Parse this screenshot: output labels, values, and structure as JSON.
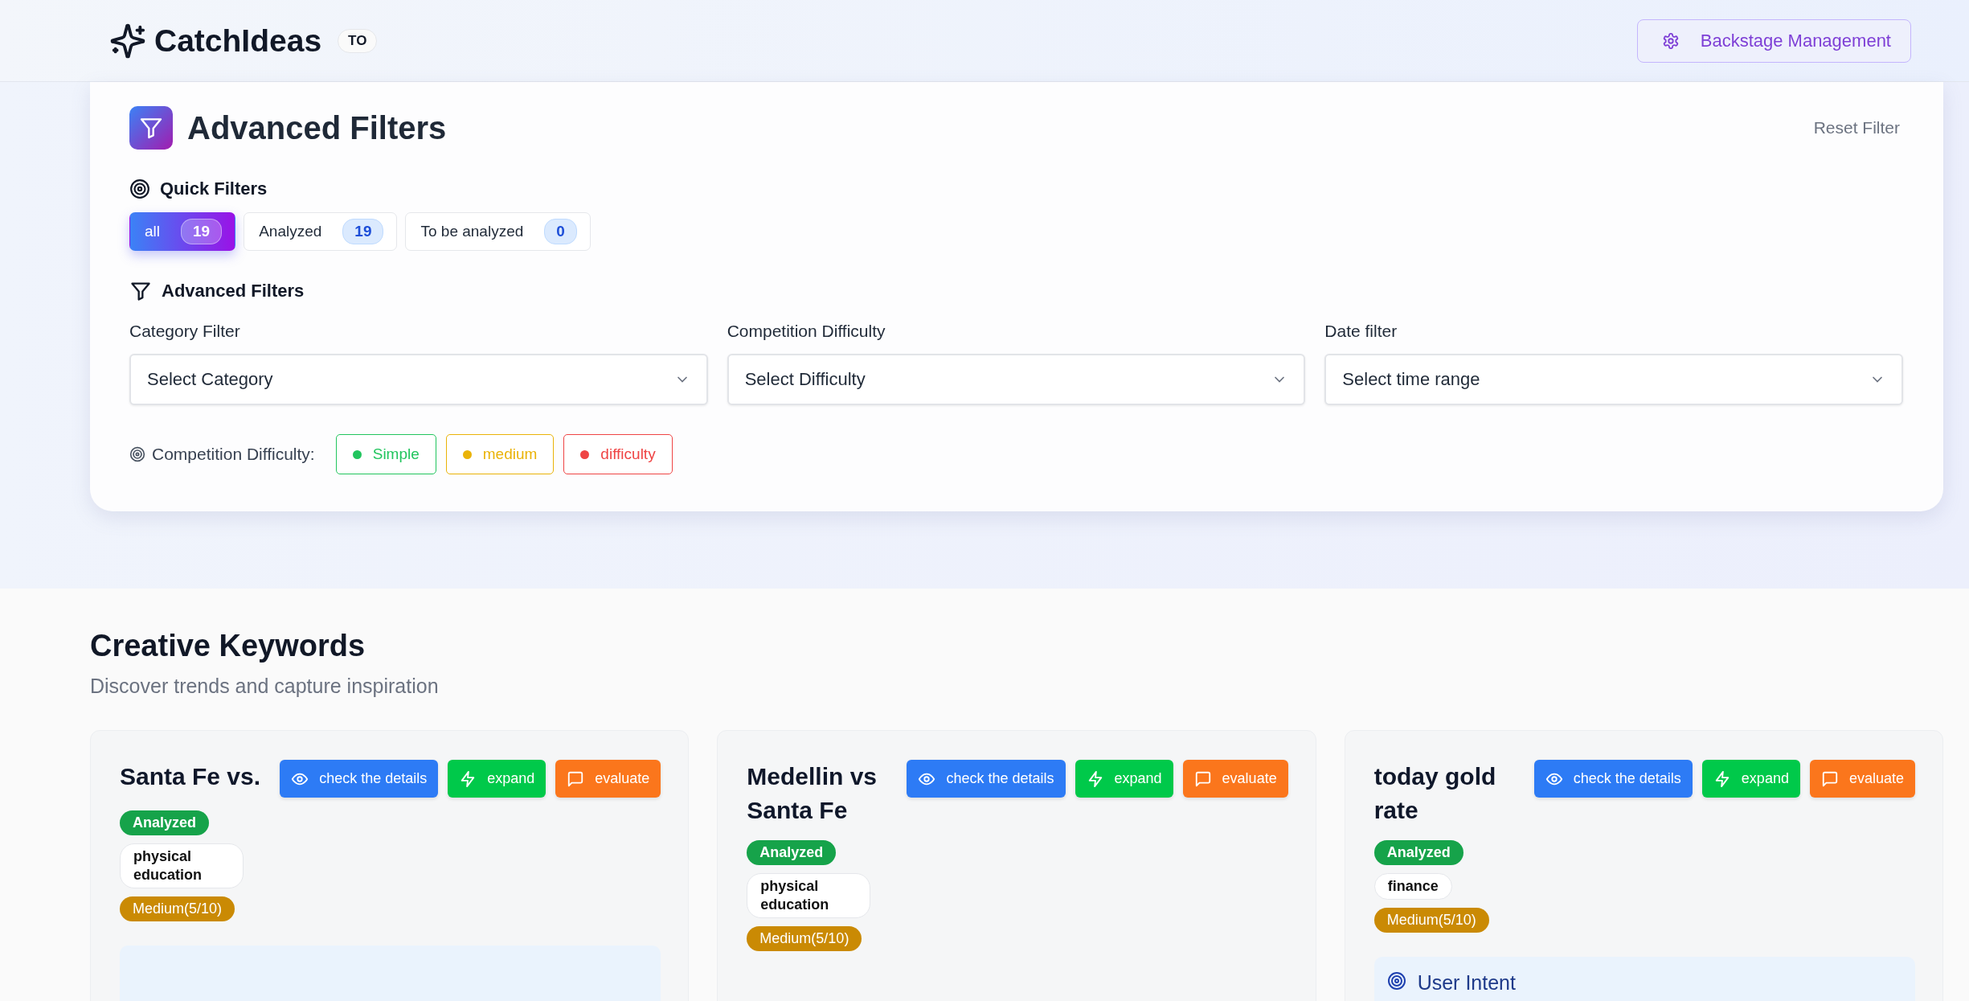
{
  "header": {
    "brand": "CatchIdeas",
    "badge": "TO",
    "admin_button": "Backstage Management"
  },
  "filters": {
    "title": "Advanced Filters",
    "reset": "Reset Filter",
    "quick_title": "Quick Filters",
    "quick": [
      {
        "label": "all",
        "count": "19",
        "selected": true
      },
      {
        "label": "Analyzed",
        "count": "19",
        "selected": false
      },
      {
        "label": "To be analyzed",
        "count": "0",
        "selected": false
      }
    ],
    "advanced_title": "Advanced Filters",
    "selects": [
      {
        "label": "Category Filter",
        "placeholder": "Select Category"
      },
      {
        "label": "Competition Difficulty",
        "placeholder": "Select Difficulty"
      },
      {
        "label": "Date filter",
        "placeholder": "Select time range"
      }
    ],
    "legend_label": "Competition Difficulty:",
    "legend": [
      {
        "label": "Simple",
        "color": "#22c55e"
      },
      {
        "label": "medium",
        "color": "#eab308"
      },
      {
        "label": "difficulty",
        "color": "#ef4444"
      }
    ]
  },
  "section": {
    "title": "Creative Keywords",
    "subtitle": "Discover trends and capture inspiration"
  },
  "cards": [
    {
      "title": "Santa Fe vs.",
      "status": "Analyzed",
      "category": "physical education",
      "difficulty": "Medium(5/10)",
      "buttons": [
        "check the details",
        "expand",
        "evaluate"
      ],
      "intent_panel": true
    },
    {
      "title": "Medellin vs Santa Fe",
      "status": "Analyzed",
      "category": "physical education",
      "difficulty": "Medium(5/10)",
      "buttons": [
        "check the details",
        "expand",
        "evaluate"
      ],
      "intent_panel": false
    },
    {
      "title": "today gold rate",
      "status": "Analyzed",
      "category": "finance",
      "difficulty": "Medium(5/10)",
      "buttons": [
        "check the details",
        "expand",
        "evaluate"
      ],
      "intent_panel": true,
      "intent_title": "User Intent"
    }
  ]
}
